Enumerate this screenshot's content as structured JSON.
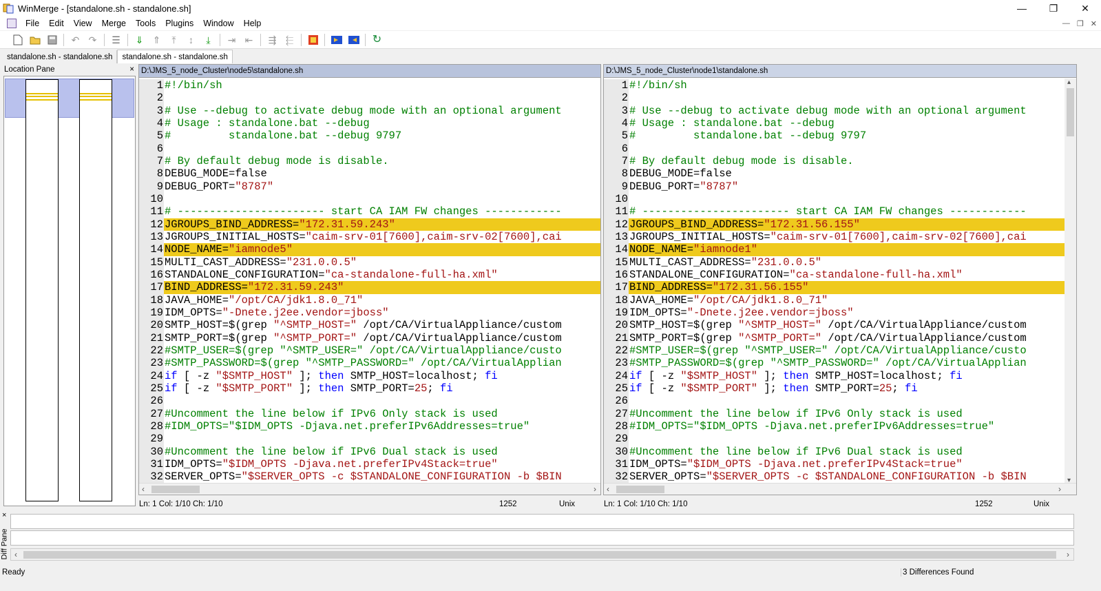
{
  "window": {
    "title": "WinMerge - [standalone.sh - standalone.sh]",
    "minimize_icon": "minimize-icon",
    "restore_icon": "restore-icon",
    "close_icon": "close-icon"
  },
  "menu": [
    "File",
    "Edit",
    "View",
    "Merge",
    "Tools",
    "Plugins",
    "Window",
    "Help"
  ],
  "tabs": [
    {
      "label": "standalone.sh - standalone.sh",
      "active": false
    },
    {
      "label": "standalone.sh - standalone.sh",
      "active": true
    }
  ],
  "location_pane": {
    "title": "Location Pane",
    "close": "×"
  },
  "left": {
    "path": "D:\\JMS_5_node_Cluster\\node5\\standalone.sh",
    "status": {
      "pos": "Ln: 1  Col: 1/10  Ch: 1/10",
      "codepage": "1252",
      "eol": "Unix"
    }
  },
  "right": {
    "path": "D:\\JMS_5_node_Cluster\\node1\\standalone.sh",
    "status": {
      "pos": "Ln: 1  Col: 1/10  Ch: 1/10",
      "codepage": "1252",
      "eol": "Unix"
    }
  },
  "lines_left": [
    "#!/bin/sh",
    "",
    "# Use --debug to activate debug mode with an optional argument",
    "# Usage : standalone.bat --debug",
    "#         standalone.bat --debug 9797",
    "",
    "# By default debug mode is disable.",
    "DEBUG_MODE=false",
    "DEBUG_PORT=\"8787\"",
    "",
    "# ----------------------- start CA IAM FW changes ------------",
    "JGROUPS_BIND_ADDRESS=\"172.31.59.243\"",
    "JGROUPS_INITIAL_HOSTS=\"caim-srv-01[7600],caim-srv-02[7600],cai",
    "NODE_NAME=\"iamnode5\"",
    "MULTI_CAST_ADDRESS=\"231.0.0.5\"",
    "STANDALONE_CONFIGURATION=\"ca-standalone-full-ha.xml\"",
    "BIND_ADDRESS=\"172.31.59.243\"",
    "JAVA_HOME=\"/opt/CA/jdk1.8.0_71\"",
    "IDM_OPTS=\"-Dnete.j2ee.vendor=jboss\"",
    "SMTP_HOST=$(grep \"^SMTP_HOST=\" /opt/CA/VirtualAppliance/custom",
    "SMTP_PORT=$(grep \"^SMTP_PORT=\" /opt/CA/VirtualAppliance/custom",
    "#SMTP_USER=$(grep \"^SMTP_USER=\" /opt/CA/VirtualAppliance/custo",
    "#SMTP_PASSWORD=$(grep \"^SMTP_PASSWORD=\" /opt/CA/VirtualApplian",
    "if [ -z \"$SMTP_HOST\" ]; then SMTP_HOST=localhost; fi",
    "if [ -z \"$SMTP_PORT\" ]; then SMTP_PORT=25; fi",
    "",
    "#Uncomment the line below if IPv6 Only stack is used",
    "#IDM_OPTS=\"$IDM_OPTS -Djava.net.preferIPv6Addresses=true\"",
    "",
    "#Uncomment the line below if IPv6 Dual stack is used",
    "IDM_OPTS=\"$IDM_OPTS -Djava.net.preferIPv4Stack=true\"",
    "SERVER_OPTS=\"$SERVER_OPTS -c $STANDALONE_CONFIGURATION -b $BIN"
  ],
  "lines_right": [
    "#!/bin/sh",
    "",
    "# Use --debug to activate debug mode with an optional argument",
    "# Usage : standalone.bat --debug",
    "#         standalone.bat --debug 9797",
    "",
    "# By default debug mode is disable.",
    "DEBUG_MODE=false",
    "DEBUG_PORT=\"8787\"",
    "",
    "# ----------------------- start CA IAM FW changes ------------",
    "JGROUPS_BIND_ADDRESS=\"172.31.56.155\"",
    "JGROUPS_INITIAL_HOSTS=\"caim-srv-01[7600],caim-srv-02[7600],cai",
    "NODE_NAME=\"iamnode1\"",
    "MULTI_CAST_ADDRESS=\"231.0.0.5\"",
    "STANDALONE_CONFIGURATION=\"ca-standalone-full-ha.xml\"",
    "BIND_ADDRESS=\"172.31.56.155\"",
    "JAVA_HOME=\"/opt/CA/jdk1.8.0_71\"",
    "IDM_OPTS=\"-Dnete.j2ee.vendor=jboss\"",
    "SMTP_HOST=$(grep \"^SMTP_HOST=\" /opt/CA/VirtualAppliance/custom",
    "SMTP_PORT=$(grep \"^SMTP_PORT=\" /opt/CA/VirtualAppliance/custom",
    "#SMTP_USER=$(grep \"^SMTP_USER=\" /opt/CA/VirtualAppliance/custo",
    "#SMTP_PASSWORD=$(grep \"^SMTP_PASSWORD=\" /opt/CA/VirtualApplian",
    "if [ -z \"$SMTP_HOST\" ]; then SMTP_HOST=localhost; fi",
    "if [ -z \"$SMTP_PORT\" ]; then SMTP_PORT=25; fi",
    "",
    "#Uncomment the line below if IPv6 Only stack is used",
    "#IDM_OPTS=\"$IDM_OPTS -Djava.net.preferIPv6Addresses=true\"",
    "",
    "#Uncomment the line below if IPv6 Dual stack is used",
    "IDM_OPTS=\"$IDM_OPTS -Djava.net.preferIPv4Stack=true\"",
    "SERVER_OPTS=\"$SERVER_OPTS -c $STANDALONE_CONFIGURATION -b $BIN"
  ],
  "diff_lines": [
    12,
    14,
    17
  ],
  "colors": {
    "diff_highlight": "#efca1d",
    "comment": "#008000",
    "string": "#a31515",
    "keyword": "#0000ff"
  },
  "diff_pane": {
    "label": "Diff Pane",
    "close": "×"
  },
  "status": {
    "left": "Ready",
    "right": "3 Differences Found"
  }
}
